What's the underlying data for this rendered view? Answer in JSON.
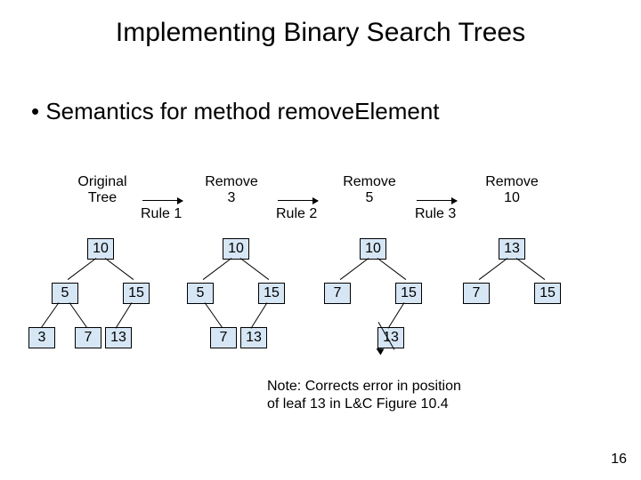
{
  "title": "Implementing Binary Search Trees",
  "bullet": "Semantics for method removeElement",
  "labels": {
    "original_l1": "Original",
    "original_l2": "Tree",
    "rule1": "Rule 1",
    "remove3_l1": "Remove",
    "remove3_l2": "3",
    "rule2": "Rule 2",
    "remove5_l1": "Remove",
    "remove5_l2": "5",
    "rule3": "Rule 3",
    "remove10_l1": "Remove",
    "remove10_l2": "10"
  },
  "trees": {
    "t1": {
      "root": "10",
      "l": "5",
      "r": "15",
      "ll": "3",
      "lr": "7",
      "rl": "13"
    },
    "t2": {
      "root": "10",
      "l": "5",
      "r": "15",
      "lr": "7",
      "rl": "13"
    },
    "t3": {
      "root": "10",
      "l": "7",
      "r": "15",
      "rl": "13"
    },
    "t4": {
      "root": "13",
      "l": "7",
      "r": "15"
    }
  },
  "note_l1": "Note: Corrects error in position",
  "note_l2": "of leaf 13 in L&C Figure 10.4",
  "pagenum": "16"
}
